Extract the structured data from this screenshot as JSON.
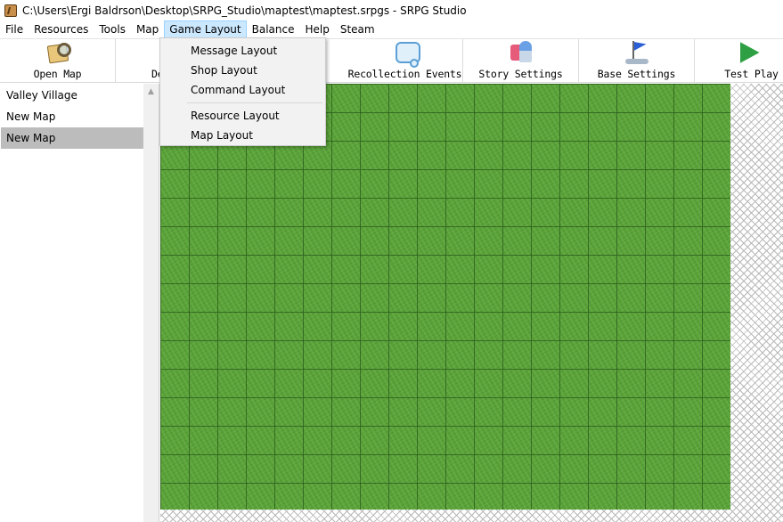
{
  "window": {
    "title": "C:\\Users\\Ergi Baldrson\\Desktop\\SRPG_Studio\\maptest\\maptest.srpgs - SRPG Studio"
  },
  "menubar": {
    "items": [
      "File",
      "Resources",
      "Tools",
      "Map",
      "Game Layout",
      "Balance",
      "Help",
      "Steam"
    ],
    "active": "Game Layout"
  },
  "toolbar": {
    "open_map": "Open Map",
    "partial_second": "De",
    "recollection_events": "Recollection Events",
    "story_settings": "Story Settings",
    "base_settings": "Base Settings",
    "test_play": "Test Play"
  },
  "icons": {
    "app": "srpg-app-icon",
    "open_map": "map-magnifier-icon",
    "recollection_events": "speech-bubble-icon",
    "story_settings": "story-scroll-icon",
    "base_settings": "flag-icon",
    "test_play": "play-arrow-icon"
  },
  "sidebar": {
    "maps": [
      "Valley Village",
      "New Map",
      "New Map"
    ],
    "selected_index": 2
  },
  "dropdown": {
    "items": [
      "Message Layout",
      "Shop Layout",
      "Command Layout",
      "Resource Layout",
      "Map Layout"
    ]
  },
  "colors": {
    "grass": "#5aa13a",
    "selection": "#bcbcbc",
    "menu_highlight": "#cce8ff"
  }
}
